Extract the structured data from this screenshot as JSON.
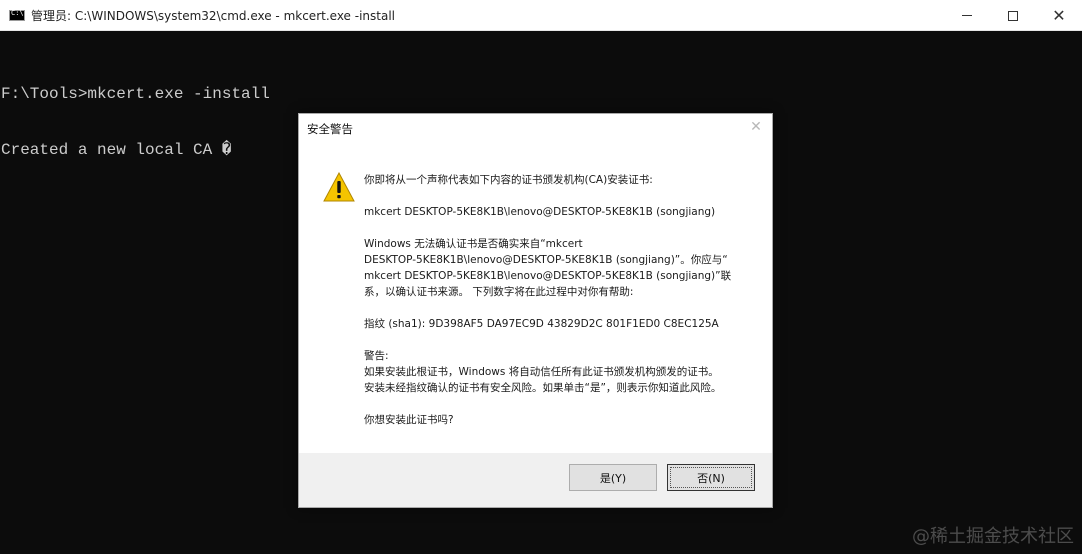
{
  "window": {
    "icon": "cmd-console-icon",
    "title": "管理员: C:\\WINDOWS\\system32\\cmd.exe - mkcert.exe  -install",
    "controls": {
      "minimize": "minimize-icon",
      "maximize": "maximize-icon",
      "close": "close-icon"
    }
  },
  "console": {
    "lines": [
      "F:\\Tools>mkcert.exe -install",
      "Created a new local CA �"
    ]
  },
  "dialog": {
    "title": "安全警告",
    "close_icon": "close-icon",
    "warning_icon": "warning-triangle-icon",
    "paragraphs": [
      [
        "你即将从一个声称代表如下内容的证书颁发机构(CA)安装证书:"
      ],
      [
        "mkcert DESKTOP-5KE8K1B\\lenovo@DESKTOP-5KE8K1B (songjiang)"
      ],
      [
        "Windows 无法确认证书是否确实来自“mkcert",
        "DESKTOP-5KE8K1B\\lenovo@DESKTOP-5KE8K1B (songjiang)”。你应与“",
        "mkcert DESKTOP-5KE8K1B\\lenovo@DESKTOP-5KE8K1B (songjiang)”联",
        "系，以确认证书来源。 下列数字将在此过程中对你有帮助:"
      ],
      [
        "指纹 (sha1): 9D398AF5 DA97EC9D 43829D2C 801F1ED0 C8EC125A"
      ],
      [
        "警告:",
        "如果安装此根证书，Windows 将自动信任所有此证书颁发机构颁发的证书。",
        "安装未经指纹确认的证书有安全风险。如果单击“是”，则表示你知道此风险。"
      ],
      [
        "你想安装此证书吗?"
      ]
    ],
    "buttons": {
      "yes": "是(Y)",
      "no": "否(N)"
    }
  },
  "watermark": "@稀土掘金技术社区"
}
